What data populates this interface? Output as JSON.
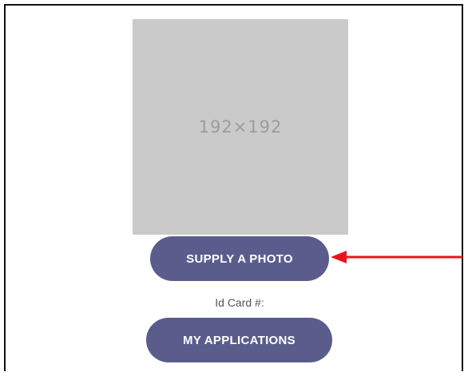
{
  "photo": {
    "placeholder_text": "192×192"
  },
  "buttons": {
    "supply_photo_label": "SUPPLY A PHOTO",
    "my_applications_label": "MY APPLICATIONS"
  },
  "id_card": {
    "label": "Id Card #:"
  },
  "annotation": {
    "arrow_color": "#e8141b",
    "arrow_icon": "left-arrow-icon"
  },
  "colors": {
    "button_background": "#5a5c8c",
    "placeholder_background": "#cacaca"
  }
}
